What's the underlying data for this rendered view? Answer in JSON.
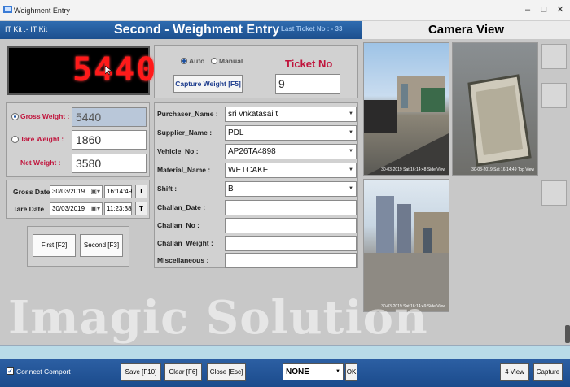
{
  "window": {
    "title": "Weighment Entry"
  },
  "header": {
    "kit": "IT Kit :- IT Kit",
    "title": "Second - Weighment Entry",
    "last_ticket": "Last Ticket No :  - 33"
  },
  "camera": {
    "title": "Camera View",
    "stamps": [
      "30-03-2019 Sat 16:14:48   Side View",
      "30-03-2019 Sat 16:14:49   Top View",
      "30-03-2019 Sat 16:14:49   Side View"
    ]
  },
  "display": {
    "value": "5440"
  },
  "weights": {
    "gross_label": "Gross Weight :",
    "gross_value": "5440",
    "tare_label": "Tare Weight :",
    "tare_value": "1860",
    "net_label": "Net Weight :",
    "net_value": "3580"
  },
  "dates": {
    "gross_label": "Gross Date",
    "gross_date": "30/03/2019",
    "gross_time": "16:14:49",
    "tare_label": "Tare Date",
    "tare_date": "30/03/2019",
    "tare_time": "11:23:38",
    "t_label": "T"
  },
  "weigh_buttons": {
    "first": "First [F2]",
    "second": "Second [F3]"
  },
  "mode": {
    "auto": "Auto",
    "manual": "Manual",
    "capture": "Capture Weight [F5]"
  },
  "ticket": {
    "label": "Ticket No",
    "value": "9"
  },
  "form": {
    "purchaser_label": "Purchaser_Name :",
    "purchaser_value": "sri vnkatasai t",
    "supplier_label": "Supplier_Name :",
    "supplier_value": "PDL",
    "vehicle_label": "Vehicle_No :",
    "vehicle_value": "AP26TA4898",
    "material_label": "Material_Name :",
    "material_value": "WETCAKE",
    "shift_label": "Shift :",
    "shift_value": "B",
    "challan_date_label": "Challan_Date :",
    "challan_date_value": "",
    "challan_no_label": "Challan_No :",
    "challan_no_value": "",
    "challan_weight_label": "Challan_Weight :",
    "challan_weight_value": "",
    "misc_label": "Miscellaneous :",
    "misc_value": ""
  },
  "watermark": "Imagic Solution",
  "bottom": {
    "connect": "Connect Comport",
    "save": "Save [F10]",
    "clear": "Clear [F6]",
    "close": "Close [Esc]",
    "select_value": "NONE",
    "ok": "OK",
    "four_view": "4 View",
    "capture": "Capture"
  }
}
